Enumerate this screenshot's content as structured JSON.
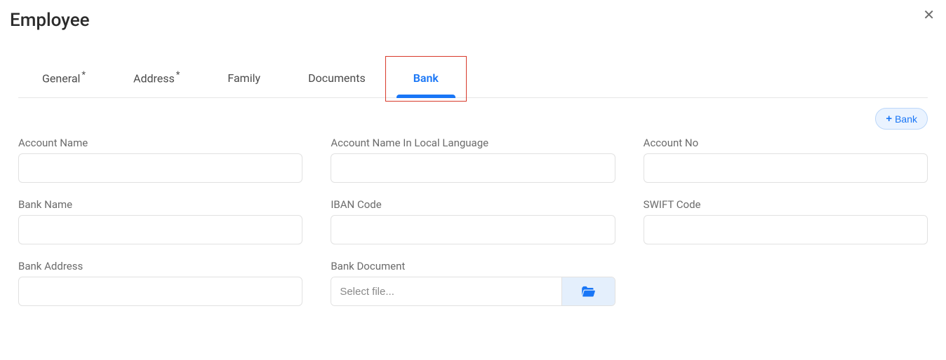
{
  "header": {
    "title": "Employee"
  },
  "tabs": [
    {
      "label": "General",
      "required": true,
      "active": false
    },
    {
      "label": "Address",
      "required": true,
      "active": false
    },
    {
      "label": "Family",
      "required": false,
      "active": false
    },
    {
      "label": "Documents",
      "required": false,
      "active": false
    },
    {
      "label": "Bank",
      "required": false,
      "active": true
    }
  ],
  "actions": {
    "add_bank_label": "Bank"
  },
  "form": {
    "account_name": {
      "label": "Account Name",
      "value": ""
    },
    "account_name_local": {
      "label": "Account Name In Local Language",
      "value": ""
    },
    "account_no": {
      "label": "Account No",
      "value": ""
    },
    "bank_name": {
      "label": "Bank Name",
      "value": ""
    },
    "iban_code": {
      "label": "IBAN Code",
      "value": ""
    },
    "swift_code": {
      "label": "SWIFT Code",
      "value": ""
    },
    "bank_address": {
      "label": "Bank Address",
      "value": ""
    },
    "bank_document": {
      "label": "Bank Document",
      "placeholder": "Select file..."
    }
  }
}
